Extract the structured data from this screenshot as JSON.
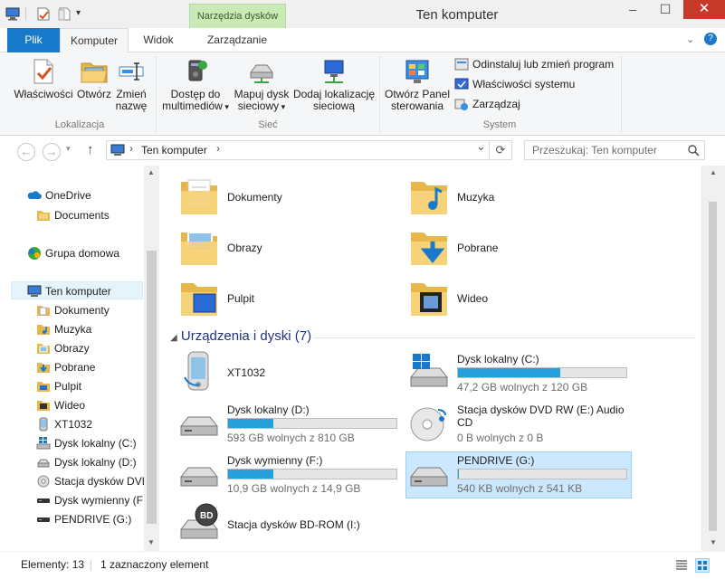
{
  "window": {
    "title": "Ten komputer",
    "context_tab": "Narzędzia dysków",
    "controls": {
      "minimize": "–",
      "maximize": "☐",
      "close": "✕"
    }
  },
  "ribbon_tabs": [
    {
      "label": "Plik"
    },
    {
      "label": "Komputer"
    },
    {
      "label": "Widok"
    },
    {
      "label": "Zarządzanie"
    }
  ],
  "ribbon": {
    "groups": {
      "lokalizacja": {
        "label": "Lokalizacja",
        "buttons": [
          {
            "label": "Właściwości",
            "icon": "properties-icon"
          },
          {
            "label": "Otwórz",
            "icon": "open-icon"
          },
          {
            "label_line1": "Zmień",
            "label_line2": "nazwę",
            "icon": "rename-icon"
          }
        ]
      },
      "siec": {
        "label": "Sieć",
        "buttons": [
          {
            "label_line1": "Dostęp do",
            "label_line2": "multimediów",
            "icon": "media-access-icon"
          },
          {
            "label_line1": "Mapuj dysk",
            "label_line2": "sieciowy",
            "icon": "map-drive-icon"
          },
          {
            "label_line1": "Dodaj lokalizację",
            "label_line2": "sieciową",
            "icon": "add-network-location-icon"
          }
        ]
      },
      "system": {
        "label": "System",
        "big_button": {
          "label_line1": "Otwórz Panel",
          "label_line2": "sterowania",
          "icon": "control-panel-icon"
        },
        "small_buttons": [
          {
            "label": "Odinstaluj lub zmień program",
            "icon": "uninstall-icon"
          },
          {
            "label": "Właściwości systemu",
            "icon": "system-properties-icon"
          },
          {
            "label": "Zarządzaj",
            "icon": "manage-icon"
          }
        ]
      }
    }
  },
  "address": {
    "path_item": "Ten komputer",
    "search_placeholder": "Przeszukaj: Ten komputer",
    "nav_back": "←",
    "nav_forward": "→",
    "nav_up": "↑",
    "refresh": "⟳",
    "separator": "›",
    "dropdown": "⌄"
  },
  "nav_pane": {
    "items": [
      {
        "label": "OneDrive",
        "icon": "onedrive-icon"
      },
      {
        "label": "Documents",
        "icon": "folder-icon"
      },
      {
        "label": "Grupa domowa",
        "icon": "homegroup-icon"
      },
      {
        "label": "Ten komputer",
        "icon": "computer-icon"
      },
      {
        "label": "Dokumenty",
        "icon": "documents-folder-icon"
      },
      {
        "label": "Muzyka",
        "icon": "music-folder-icon"
      },
      {
        "label": "Obrazy",
        "icon": "pictures-folder-icon"
      },
      {
        "label": "Pobrane",
        "icon": "downloads-folder-icon"
      },
      {
        "label": "Pulpit",
        "icon": "desktop-folder-icon"
      },
      {
        "label": "Wideo",
        "icon": "videos-folder-icon"
      },
      {
        "label": "XT1032",
        "icon": "phone-icon"
      },
      {
        "label": "Dysk lokalny (C:)",
        "icon": "windows-drive-icon"
      },
      {
        "label": "Dysk lokalny (D:)",
        "icon": "hard-drive-icon"
      },
      {
        "label": "Stacja dysków DVD",
        "icon": "dvd-drive-icon"
      },
      {
        "label": "Dysk wymienny (F:",
        "icon": "removable-drive-icon"
      },
      {
        "label": "PENDRIVE (G:)",
        "icon": "usb-drive-icon"
      }
    ]
  },
  "folders": [
    {
      "label": "Dokumenty",
      "icon": "documents-folder-icon"
    },
    {
      "label": "Muzyka",
      "icon": "music-folder-icon"
    },
    {
      "label": "Obrazy",
      "icon": "pictures-folder-icon"
    },
    {
      "label": "Pobrane",
      "icon": "downloads-folder-icon"
    },
    {
      "label": "Pulpit",
      "icon": "desktop-folder-icon"
    },
    {
      "label": "Wideo",
      "icon": "videos-folder-icon"
    }
  ],
  "devices_section": {
    "label": "Urządzenia i dyski (7)",
    "collapse_glyph": "◢"
  },
  "devices": [
    {
      "label": "XT1032",
      "icon": "phone-icon"
    },
    {
      "label": "Dysk lokalny (C:)",
      "free": "47,2 GB wolnych z 120 GB",
      "used_fraction": 0.607,
      "icon": "windows-drive-icon"
    },
    {
      "label": "Dysk lokalny (D:)",
      "free": "593 GB wolnych z 810 GB",
      "used_fraction": 0.268,
      "icon": "hard-drive-icon"
    },
    {
      "label_line1": "Stacja dysków DVD RW (E:) Audio",
      "label_line2": "CD",
      "free": "0 B wolnych z 0 B",
      "icon": "dvd-drive-icon"
    },
    {
      "label": "Dysk wymienny (F:)",
      "free": "10,9 GB wolnych z 14,9 GB",
      "used_fraction": 0.268,
      "icon": "removable-drive-icon"
    },
    {
      "label": "PENDRIVE (G:)",
      "free": "540 KB wolnych z 541 KB",
      "used_fraction": 0.002,
      "icon": "usb-drive-icon",
      "selected": true
    },
    {
      "label": "Stacja dysków BD-ROM (I:)",
      "icon": "bd-rom-drive-icon"
    }
  ],
  "status": {
    "items": "Elementy: 13",
    "selected": "1 zaznaczony element"
  },
  "colors": {
    "accent": "#1979ca",
    "drive_fill": "#26a0da",
    "selection": "#cce8ff",
    "close": "#c7392b",
    "context_tab": "#c9e9b6"
  }
}
